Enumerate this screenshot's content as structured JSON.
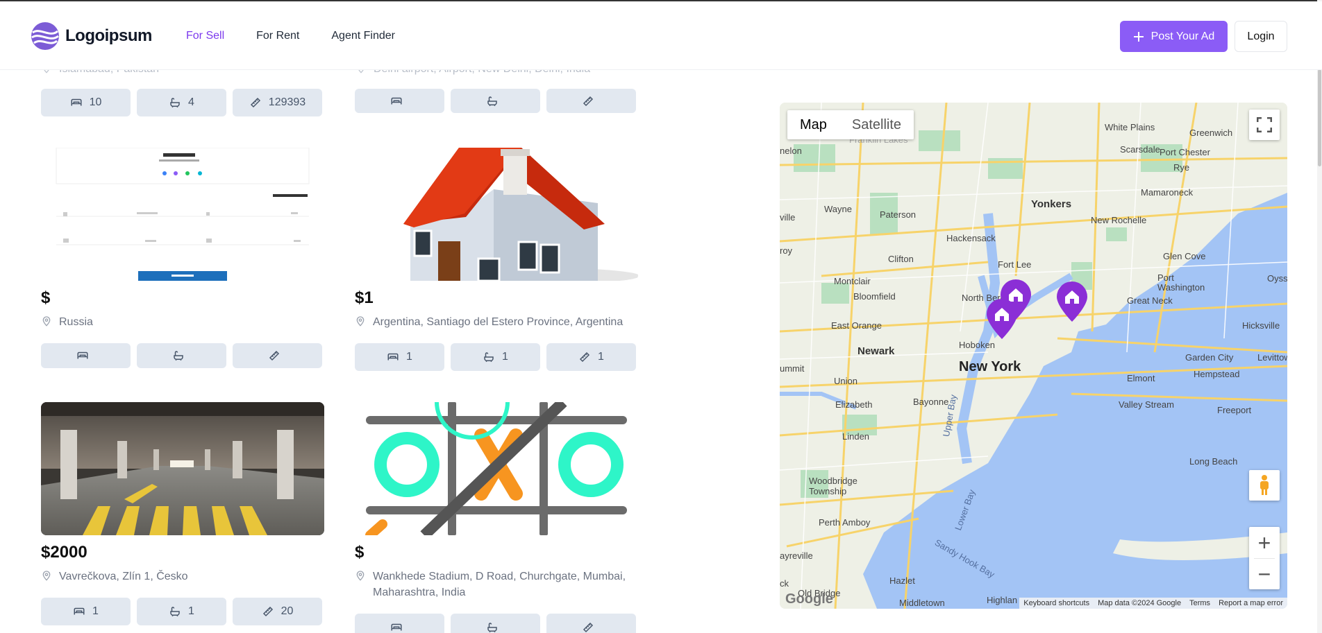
{
  "header": {
    "logo_text": "Logoipsum",
    "nav": [
      {
        "label": "For Sell",
        "active": true
      },
      {
        "label": "For Rent",
        "active": false
      },
      {
        "label": "Agent Finder",
        "active": false
      }
    ],
    "post_ad_label": "Post Your Ad",
    "login_label": "Login",
    "accent_color": "#8b5cf6"
  },
  "listings": {
    "top_row": [
      {
        "location": "Islamabad, Pakistan",
        "beds": "10",
        "baths": "4",
        "area": "129393"
      },
      {
        "location": "Delhi airport, Airport, New Delhi, Delhi, India",
        "beds": "",
        "baths": "",
        "area": ""
      }
    ],
    "middle_row": [
      {
        "price": "$",
        "location": "Russia",
        "beds": "",
        "baths": "",
        "area": ""
      },
      {
        "price": "$1",
        "location": "Argentina, Santiago del Estero Province, Argentina",
        "beds": "1",
        "baths": "1",
        "area": "1"
      }
    ],
    "bottom_row": [
      {
        "price": "$2000",
        "location": "Vavrečkova, Zlín 1, Česko",
        "beds": "1",
        "baths": "1",
        "area": "20"
      },
      {
        "price": "$",
        "location": "Wankhede Stadium, D Road, Churchgate, Mumbai, Maharashtra, India",
        "beds": "",
        "baths": "",
        "area": ""
      }
    ]
  },
  "map": {
    "type_map": "Map",
    "type_satellite": "Satellite",
    "labels": {
      "yonkers": "Yonkers",
      "white_plains": "White Plains",
      "greenwich": "Greenwich",
      "scarsdale": "Scarsdale",
      "port_chester": "Port Chester",
      "rye": "Rye",
      "mamaroneck": "Mamaroneck",
      "new_rochelle": "New Rochelle",
      "wayne": "Wayne",
      "paterson": "Paterson",
      "hackensack": "Hackensack",
      "clifton": "Clifton",
      "fort_lee": "Fort Lee",
      "glen_cove": "Glen Cove",
      "montclair": "Montclair",
      "bloomfield": "Bloomfield",
      "north_bergen": "North Bergen",
      "port_washington": "Port Washington",
      "great_neck": "Great Neck",
      "east_orange": "East Orange",
      "newark": "Newark",
      "hoboken": "Hoboken",
      "new_york": "New York",
      "hicksville": "Hicksville",
      "union": "Union",
      "garden_city": "Garden City",
      "hempstead": "Hempstead",
      "elmont": "Elmont",
      "levittown": "Levittown",
      "elizabeth": "Elizabeth",
      "bayonne": "Bayonne",
      "valley_stream": "Valley Stream",
      "freeport": "Freeport",
      "linden": "Linden",
      "long_beach": "Long Beach",
      "woodbridge": "Woodbridge Township",
      "perth_amboy": "Perth Amboy",
      "sayreville": "ayreville",
      "hazlet": "Hazlet",
      "middletown": "Middletown",
      "old_bridge": "Old Bridge",
      "highlands": "Highlan",
      "upper_bay": "Upper Bay",
      "lower_bay": "Lower Bay",
      "sandy_hook_bay": "Sandy Hook Bay",
      "nelon": "nelon",
      "ville": "ville",
      "roy": "roy",
      "ummit": "ummit",
      "ck": "ck",
      "syss": "Oyss",
      "franklin_lakes": "Franklin Lakes"
    },
    "footer": [
      "Keyboard shortcuts",
      "Map data ©2024 Google",
      "Terms",
      "Report a map error"
    ],
    "google_mark": "Google",
    "zoom_in": "+",
    "zoom_out": "−"
  }
}
